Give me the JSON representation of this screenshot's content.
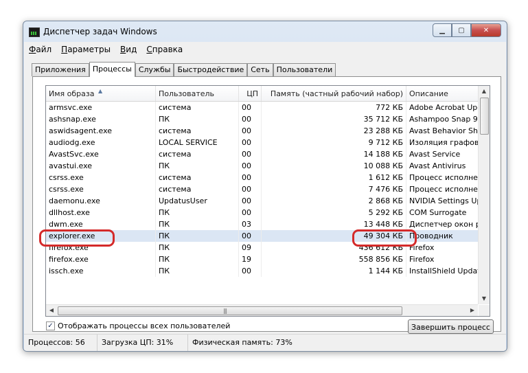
{
  "window": {
    "title": "Диспетчер задач Windows"
  },
  "menu": [
    {
      "pre": "",
      "u": "Ф",
      "post": "айл"
    },
    {
      "pre": "",
      "u": "П",
      "post": "араметры"
    },
    {
      "pre": "",
      "u": "В",
      "post": "ид"
    },
    {
      "pre": "",
      "u": "С",
      "post": "правка"
    }
  ],
  "tabs": [
    "Приложения",
    "Процессы",
    "Службы",
    "Быстродействие",
    "Сеть",
    "Пользователи"
  ],
  "active_tab": "Процессы",
  "columns": {
    "name": "Имя образа",
    "user": "Пользователь",
    "cpu": "ЦП",
    "memory": "Память (частный рабочий набор)",
    "description": "Описание"
  },
  "processes": [
    {
      "name": "armsvc.exe",
      "user": "система",
      "cpu": "00",
      "memory": "772 КБ",
      "description": "Adobe Acrobat Upd"
    },
    {
      "name": "ashsnap.exe",
      "user": "ПК",
      "cpu": "00",
      "memory": "35 712 КБ",
      "description": "Ashampoo Snap 9"
    },
    {
      "name": "aswidsagent.exe",
      "user": "система",
      "cpu": "00",
      "memory": "23 288 КБ",
      "description": "Avast Behavior Shi"
    },
    {
      "name": "audiodg.exe",
      "user": "LOCAL SERVICE",
      "cpu": "00",
      "memory": "9 712 КБ",
      "description": "Изоляция графов"
    },
    {
      "name": "AvastSvc.exe",
      "user": "система",
      "cpu": "00",
      "memory": "14 188 КБ",
      "description": "Avast Service"
    },
    {
      "name": "avastui.exe",
      "user": "ПК",
      "cpu": "00",
      "memory": "10 088 КБ",
      "description": "Avast Antivirus"
    },
    {
      "name": "csrss.exe",
      "user": "система",
      "cpu": "00",
      "memory": "1 612 КБ",
      "description": "Процесс исполнен"
    },
    {
      "name": "csrss.exe",
      "user": "система",
      "cpu": "00",
      "memory": "7 476 КБ",
      "description": "Процесс исполнен"
    },
    {
      "name": "daemonu.exe",
      "user": "UpdatusUser",
      "cpu": "00",
      "memory": "2 868 КБ",
      "description": "NVIDIA Settings Up"
    },
    {
      "name": "dllhost.exe",
      "user": "ПК",
      "cpu": "00",
      "memory": "5 292 КБ",
      "description": "COM Surrogate"
    },
    {
      "name": "dwm.exe",
      "user": "ПК",
      "cpu": "03",
      "memory": "13 448 КБ",
      "description": "Диспетчер окон р"
    },
    {
      "name": "explorer.exe",
      "user": "ПК",
      "cpu": "00",
      "memory": "49 304 КБ",
      "description": "Проводник",
      "selected": true
    },
    {
      "name": "firefox.exe",
      "user": "ПК",
      "cpu": "09",
      "memory": "436 612 КБ",
      "description": "Firefox"
    },
    {
      "name": "firefox.exe",
      "user": "ПК",
      "cpu": "19",
      "memory": "558 856 КБ",
      "description": "Firefox"
    },
    {
      "name": "issch.exe",
      "user": "ПК",
      "cpu": "00",
      "memory": "1 144 КБ",
      "description": "InstallShield Updat"
    }
  ],
  "show_all_label": "Отображать процессы всех пользователей",
  "show_all_checked": true,
  "end_process_label": "Завершить процесс",
  "status": {
    "processes": "Процессов: 56",
    "cpu": "Загрузка ЦП: 31%",
    "memory": "Физическая память: 73%"
  }
}
